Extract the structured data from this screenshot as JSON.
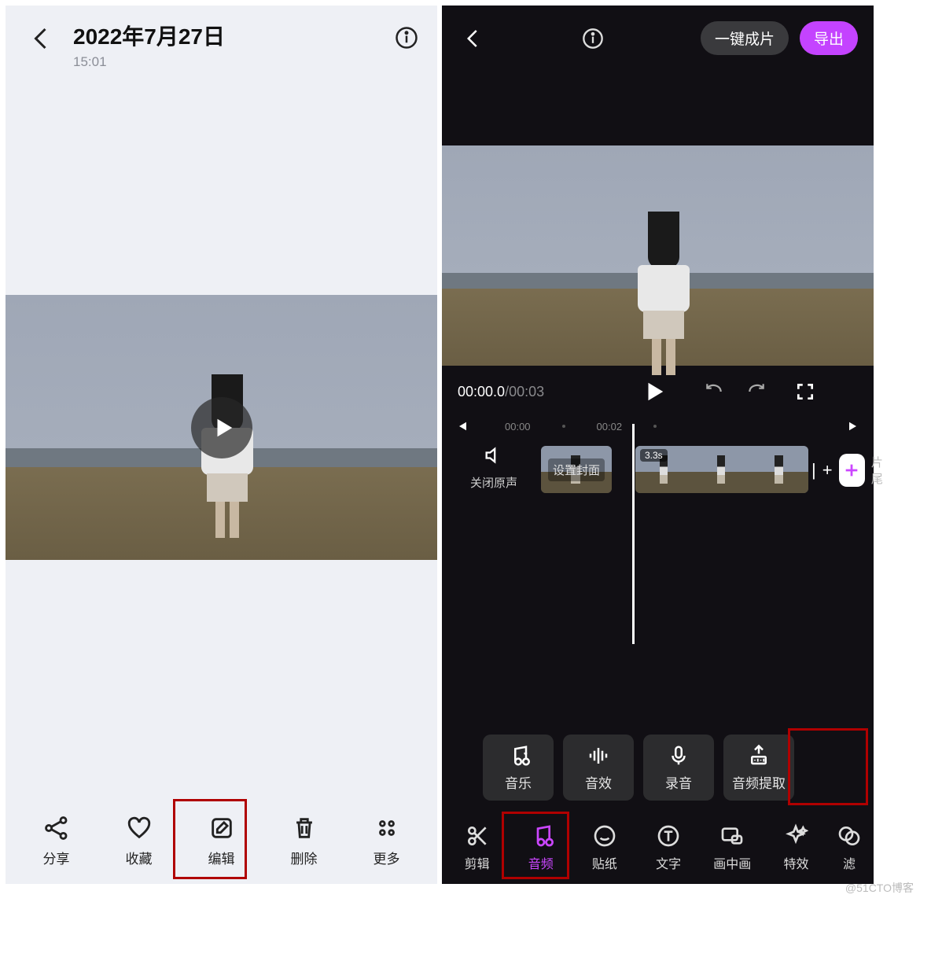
{
  "left": {
    "date": "2022年7月27日",
    "time": "15:01",
    "toolbar": {
      "share": "分享",
      "favorite": "收藏",
      "edit": "编辑",
      "delete": "删除",
      "more": "更多"
    }
  },
  "right": {
    "oneclick": "一键成片",
    "export": "导出",
    "time_current": "00:00.0",
    "time_sep": " / ",
    "time_duration": "00:03",
    "ruler": {
      "t0": "00:00",
      "t1": "00:02"
    },
    "mute_label": "关闭原声",
    "cover_label": "设置封面",
    "clip_duration": "3.3s",
    "tail_label": "片尾",
    "plus_sep": "+",
    "clip_handle": "|",
    "audio_tools": {
      "music": "音乐",
      "sfx": "音效",
      "record": "录音",
      "extract": "音频提取"
    },
    "bottom": {
      "cut": "剪辑",
      "audio": "音频",
      "sticker": "贴纸",
      "text": "文字",
      "pip": "画中画",
      "effect": "特效",
      "filter": "滤"
    }
  },
  "watermark": "@51CTO博客"
}
